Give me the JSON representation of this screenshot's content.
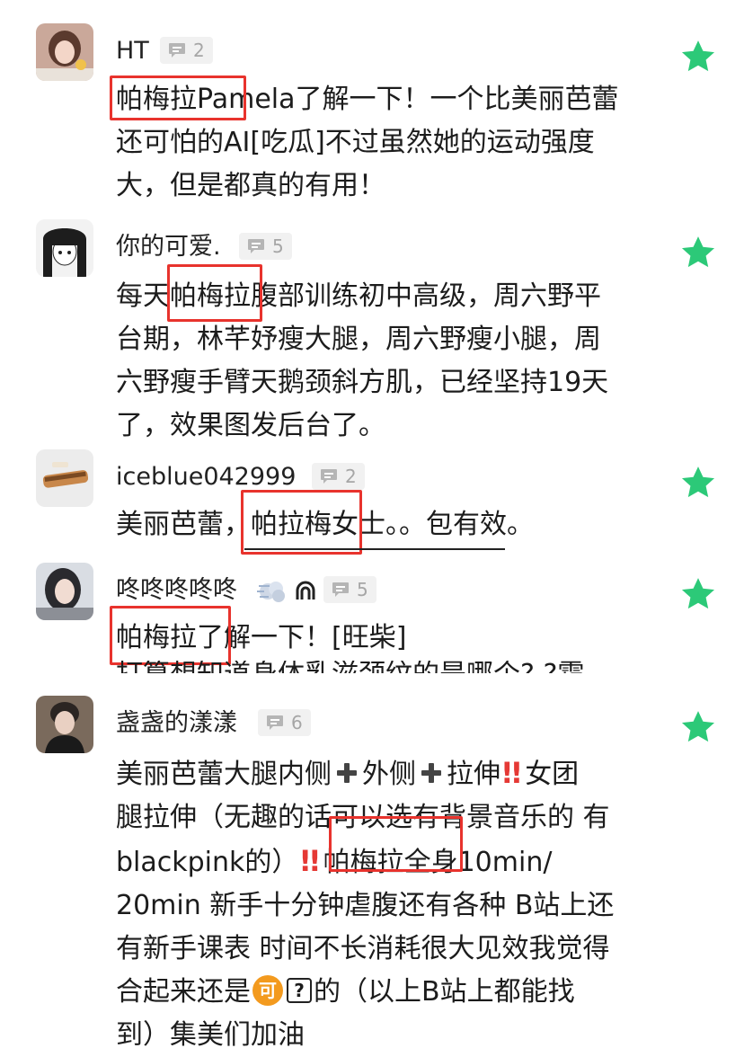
{
  "comments": [
    {
      "username": "HT",
      "reply_count": "2",
      "lines": [
        "帕梅拉Pamela了解一下！一个比美丽芭蕾",
        "还可怕的AI[吃瓜]不过虽然她的运动强度",
        "大，但是都真的有用！"
      ]
    },
    {
      "username": "你的可爱.",
      "reply_count": "5",
      "lines": [
        "每天帕梅拉腹部训练初中高级，周六野平",
        "台期，林芊妤瘦大腿，周六野瘦小腿，周",
        "六野瘦手臂天鹅颈斜方肌，已经坚持19天",
        "了，效果图发后台了。"
      ]
    },
    {
      "username": "iceblue042999",
      "reply_count": "2",
      "lines": [
        "美丽芭蕾，帕拉梅女士。。包有效。"
      ]
    },
    {
      "username": "咚咚咚咚咚",
      "reply_count": "5",
      "lines": [
        "帕梅拉了解一下！[旺柴]",
        "打算想知道身体乳滋颈纹的是哪个? ?霜"
      ]
    },
    {
      "username": "盏盏的漾漾",
      "reply_count": "6",
      "line1_a": "美丽芭蕾大腿内侧",
      "line1_b": "外侧",
      "line1_c": "拉伸",
      "line1_d": "女团",
      "line2": "腿拉伸（无趣的话可以选有背景音乐的 有",
      "line3_a": "blackpink的）",
      "line3_b": "帕梅拉全身10min/",
      "line4": "20min 新手十分钟虐腹还有各种 B站上还",
      "line5": "有新手课表 时间不长消耗很大见效我觉得",
      "line6_a": "合起来还是",
      "line6_b": "的（以上B站上都能找",
      "line7": "到）集美们加油",
      "emoji_ke": "可",
      "emoji_q": "?",
      "bang": "!!"
    }
  ],
  "colors": {
    "star": "#2cc978",
    "highlight": "#e8332d",
    "badge_bg": "#f1f1f1",
    "badge_text": "#a6a6a6"
  }
}
